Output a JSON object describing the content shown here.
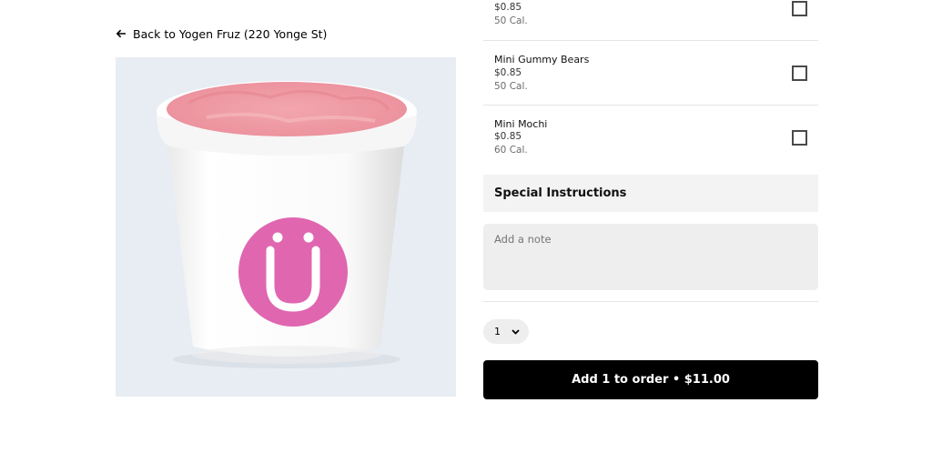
{
  "back_link": {
    "label": "Back to Yogen Fruz (220 Yonge St)"
  },
  "product_image": {
    "alt": "Yogen Fruz cup"
  },
  "toppings": [
    {
      "name": "",
      "price": "$0.85",
      "calories": "50 Cal.",
      "checked": false
    },
    {
      "name": "Mini Gummy Bears",
      "price": "$0.85",
      "calories": "50 Cal.",
      "checked": false
    },
    {
      "name": "Mini Mochi",
      "price": "$0.85",
      "calories": "60 Cal.",
      "checked": false
    }
  ],
  "special_instructions": {
    "title": "Special Instructions",
    "note_placeholder": "Add a note",
    "note_value": ""
  },
  "quantity": {
    "value": "1"
  },
  "add_button": {
    "label": "Add 1 to order • $11.00"
  },
  "colors": {
    "button_bg": "#000000",
    "logo_pink": "#e066b0",
    "image_bg": "#e8edf4"
  }
}
